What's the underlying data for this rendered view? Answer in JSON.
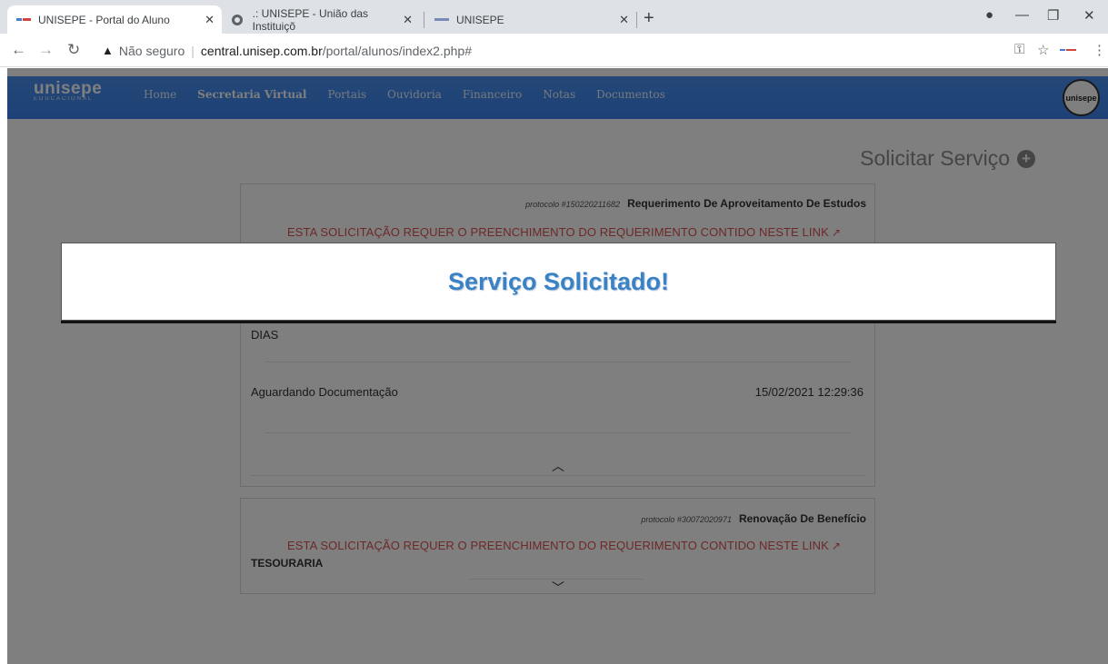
{
  "browser": {
    "tabs": [
      {
        "title": "UNISEPE - Portal do Aluno",
        "active": true
      },
      {
        "title": ".: UNISEPE - União das Instituiçõ",
        "active": false
      },
      {
        "title": "UNISEPE",
        "active": false
      }
    ],
    "omnibox": {
      "security_label": "Não seguro",
      "host": "central.unisep.com.br",
      "path": "/portal/alunos/index2.php#"
    }
  },
  "site": {
    "logo_main": "unisepe",
    "logo_sub": "EDUCACIONAL",
    "badge_text": "unisepe",
    "nav": [
      "Home",
      "Secretaria Virtual",
      "Portais",
      "Ouvidoria",
      "Financeiro",
      "Notas",
      "Documentos"
    ]
  },
  "main": {
    "solicitar_label": "Solicitar Serviço",
    "requests": [
      {
        "protocol": "protocolo #150220211682",
        "title": "Requerimento De Aproveitamento De Estudos",
        "link_text": "ESTA SOLICITAÇÃO REQUER O PREENCHIMENTO DO REQUERIMENTO CONTIDO NESTE LINK",
        "partial_text": "DIAS",
        "status": "Aguardando Documentação",
        "date": "15/02/2021 12:29:36"
      },
      {
        "protocol": "protocolo #30072020971",
        "title": "Renovação De Benefício",
        "link_text": "ESTA SOLICITAÇÃO REQUER O PREENCHIMENTO DO REQUERIMENTO CONTIDO NESTE LINK",
        "department": "TESOURARIA"
      }
    ]
  },
  "modal": {
    "title": "Serviço Solicitado!"
  },
  "colors": {
    "nav_blue": "#3b82ee",
    "link_red": "#d9534f",
    "modal_text": "#3b82c4"
  }
}
